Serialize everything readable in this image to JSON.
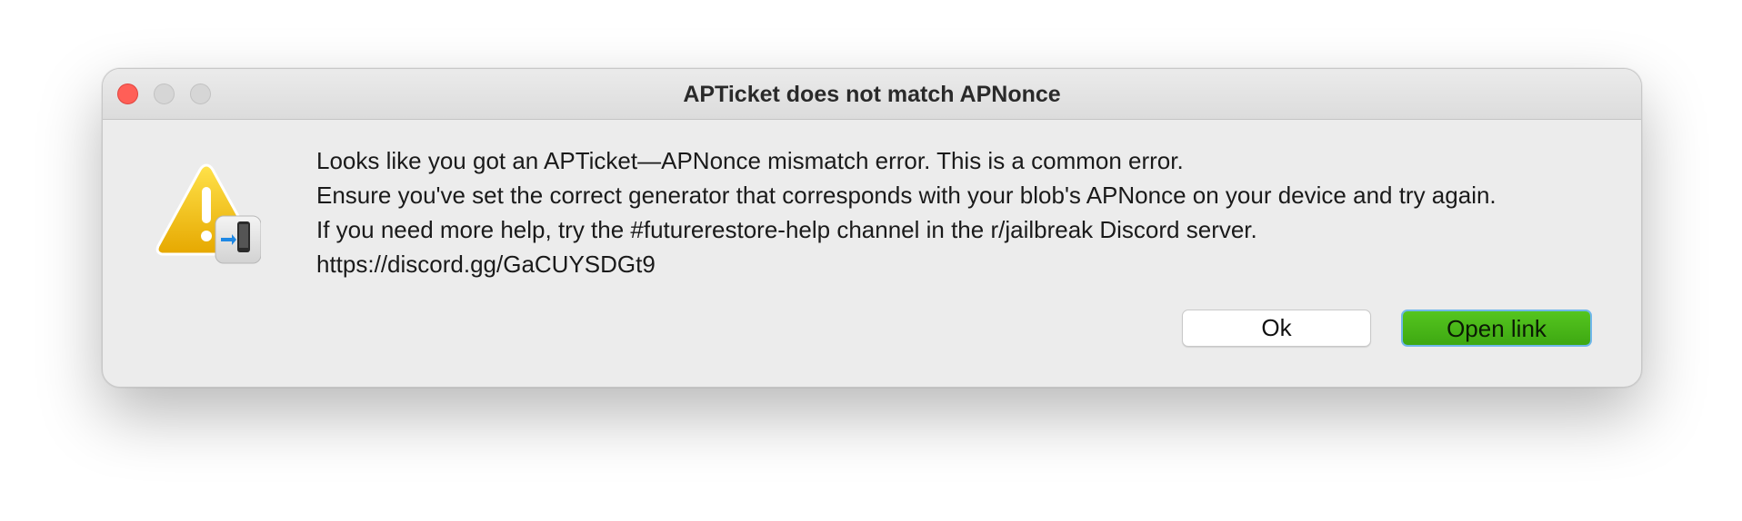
{
  "dialog": {
    "title": "APTicket does not match APNonce",
    "icon": "warning-with-device-icon",
    "message_lines": [
      "Looks like you got an APTicket—APNonce mismatch error. This is a common error.",
      "Ensure you've set the correct generator that corresponds with your blob's APNonce on your device and try again.",
      "If you need more help, try the #futurerestore-help channel in the r/jailbreak Discord server.",
      "https://discord.gg/GaCUYSDGt9"
    ],
    "buttons": {
      "ok_label": "Ok",
      "open_link_label": "Open link"
    }
  },
  "colors": {
    "close_button": "#ff5f57",
    "inactive_button": "#d6d6d6",
    "primary_button": "#46b318",
    "dialog_background": "#ececec"
  }
}
